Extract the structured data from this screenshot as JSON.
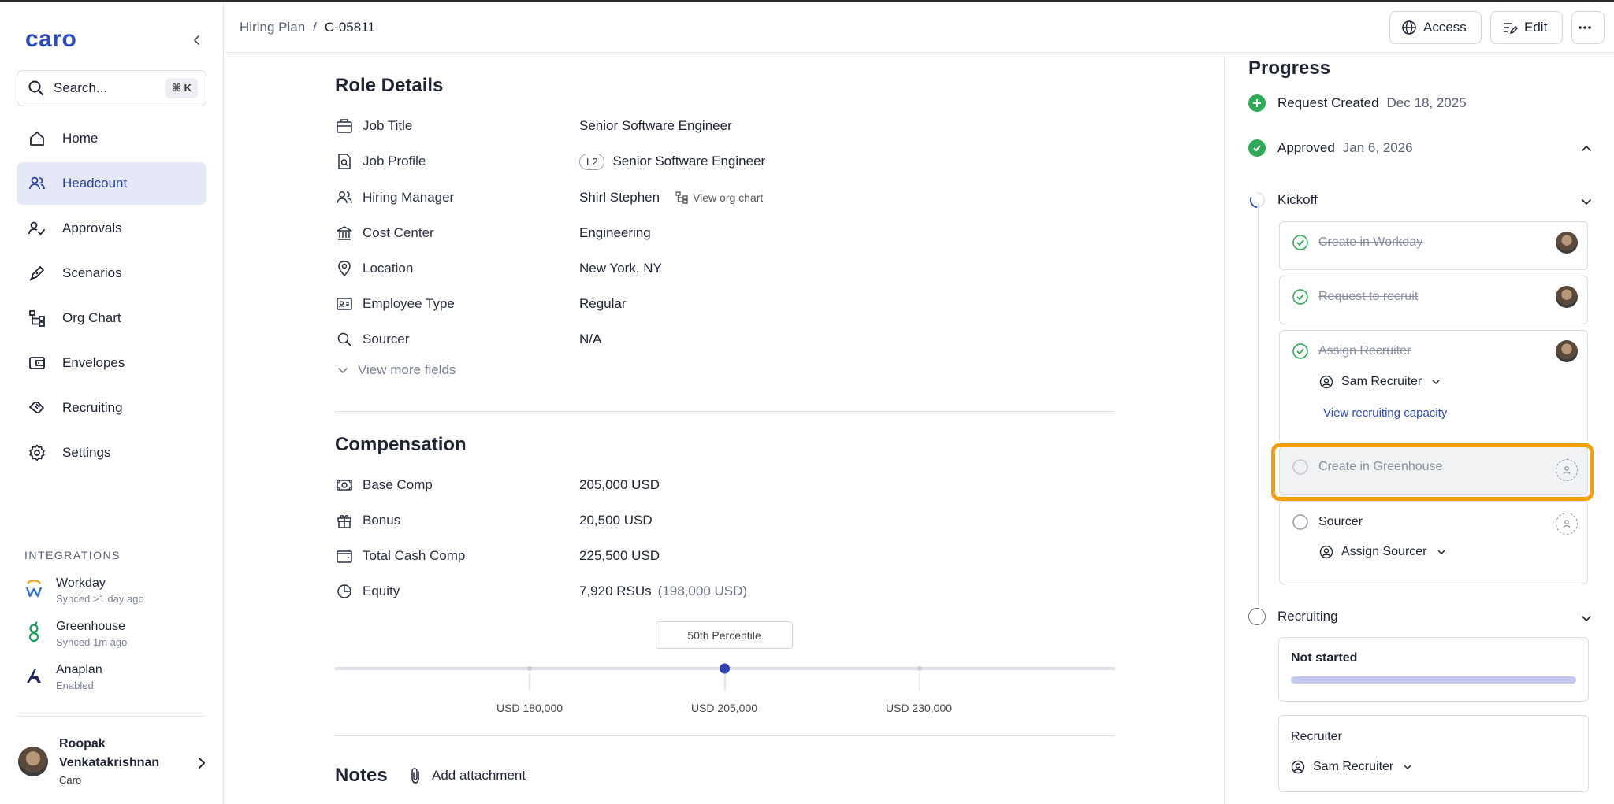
{
  "app": {
    "logo": "caro"
  },
  "search": {
    "placeholder": "Search...",
    "shortcut": "⌘ K"
  },
  "nav": {
    "items": [
      {
        "label": "Home",
        "icon": "home-icon"
      },
      {
        "label": "Headcount",
        "icon": "people-icon",
        "active": true
      },
      {
        "label": "Approvals",
        "icon": "approvals-icon"
      },
      {
        "label": "Scenarios",
        "icon": "pen-icon"
      },
      {
        "label": "Org Chart",
        "icon": "org-chart-icon"
      },
      {
        "label": "Envelopes",
        "icon": "wallet-icon"
      },
      {
        "label": "Recruiting",
        "icon": "handshake-icon"
      },
      {
        "label": "Settings",
        "icon": "gear-icon"
      }
    ]
  },
  "integrations": {
    "title": "INTEGRATIONS",
    "items": [
      {
        "name": "Workday",
        "status": "Synced >1 day ago"
      },
      {
        "name": "Greenhouse",
        "status": "Synced 1m ago"
      },
      {
        "name": "Anaplan",
        "status": "Enabled"
      }
    ]
  },
  "user": {
    "name_line1": "Roopak",
    "name_line2": "Venkatakrishnan",
    "org": "Caro"
  },
  "breadcrumb": {
    "parent": "Hiring Plan",
    "separator": "/",
    "current": "C-05811"
  },
  "toolbar": {
    "access_label": "Access",
    "edit_label": "Edit"
  },
  "role_details": {
    "title": "Role Details",
    "fields": [
      {
        "label": "Job Title",
        "value": "Senior Software Engineer"
      },
      {
        "label": "Job Profile",
        "badge": "L2",
        "value": "Senior Software Engineer"
      },
      {
        "label": "Hiring Manager",
        "value": "Shirl Stephen",
        "link": "View org chart"
      },
      {
        "label": "Cost Center",
        "value": "Engineering"
      },
      {
        "label": "Location",
        "value": "New York, NY"
      },
      {
        "label": "Employee Type",
        "value": "Regular"
      },
      {
        "label": "Sourcer",
        "value": "N/A"
      }
    ],
    "view_more": "View more fields"
  },
  "compensation": {
    "title": "Compensation",
    "fields": [
      {
        "label": "Base Comp",
        "value": "205,000 USD"
      },
      {
        "label": "Bonus",
        "value": "20,500 USD"
      },
      {
        "label": "Total Cash Comp",
        "value": "225,500 USD"
      },
      {
        "label": "Equity",
        "value": "7,920 RSUs",
        "secondary": "(198,000 USD)"
      }
    ],
    "percentile_label": "50th Percentile",
    "range": {
      "min_label": "USD 180,000",
      "mid_label": "USD 205,000",
      "max_label": "USD 230,000",
      "value": 205000,
      "min": 180000,
      "max": 230000
    }
  },
  "notes": {
    "title": "Notes",
    "attach_label": "Add attachment"
  },
  "progress": {
    "title": "Progress",
    "steps": [
      {
        "label": "Request Created",
        "date": "Dec 18, 2025",
        "state": "created"
      },
      {
        "label": "Approved",
        "date": "Jan 6, 2026",
        "state": "done"
      },
      {
        "label": "Kickoff",
        "state": "in-progress"
      },
      {
        "label": "Recruiting",
        "state": "pending"
      }
    ],
    "kickoff_tasks": [
      {
        "label": "Create in Workday",
        "done": true
      },
      {
        "label": "Request to recruit",
        "done": true
      },
      {
        "label": "Assign Recruiter",
        "done": true,
        "assignee": "Sam Recruiter",
        "link": "View recruiting capacity"
      },
      {
        "label": "Create in Greenhouse",
        "done": false
      },
      {
        "label": "Sourcer",
        "done": false,
        "assignee": "Assign Sourcer"
      }
    ],
    "recruiting": {
      "status": "Not started",
      "recruiter_title": "Recruiter",
      "recruiter_name": "Sam Recruiter"
    }
  },
  "colors": {
    "accent": "#2f4bbd",
    "success": "#2eaa57",
    "highlight": "#f5a00a",
    "range_fill": "#5a4fcf"
  }
}
